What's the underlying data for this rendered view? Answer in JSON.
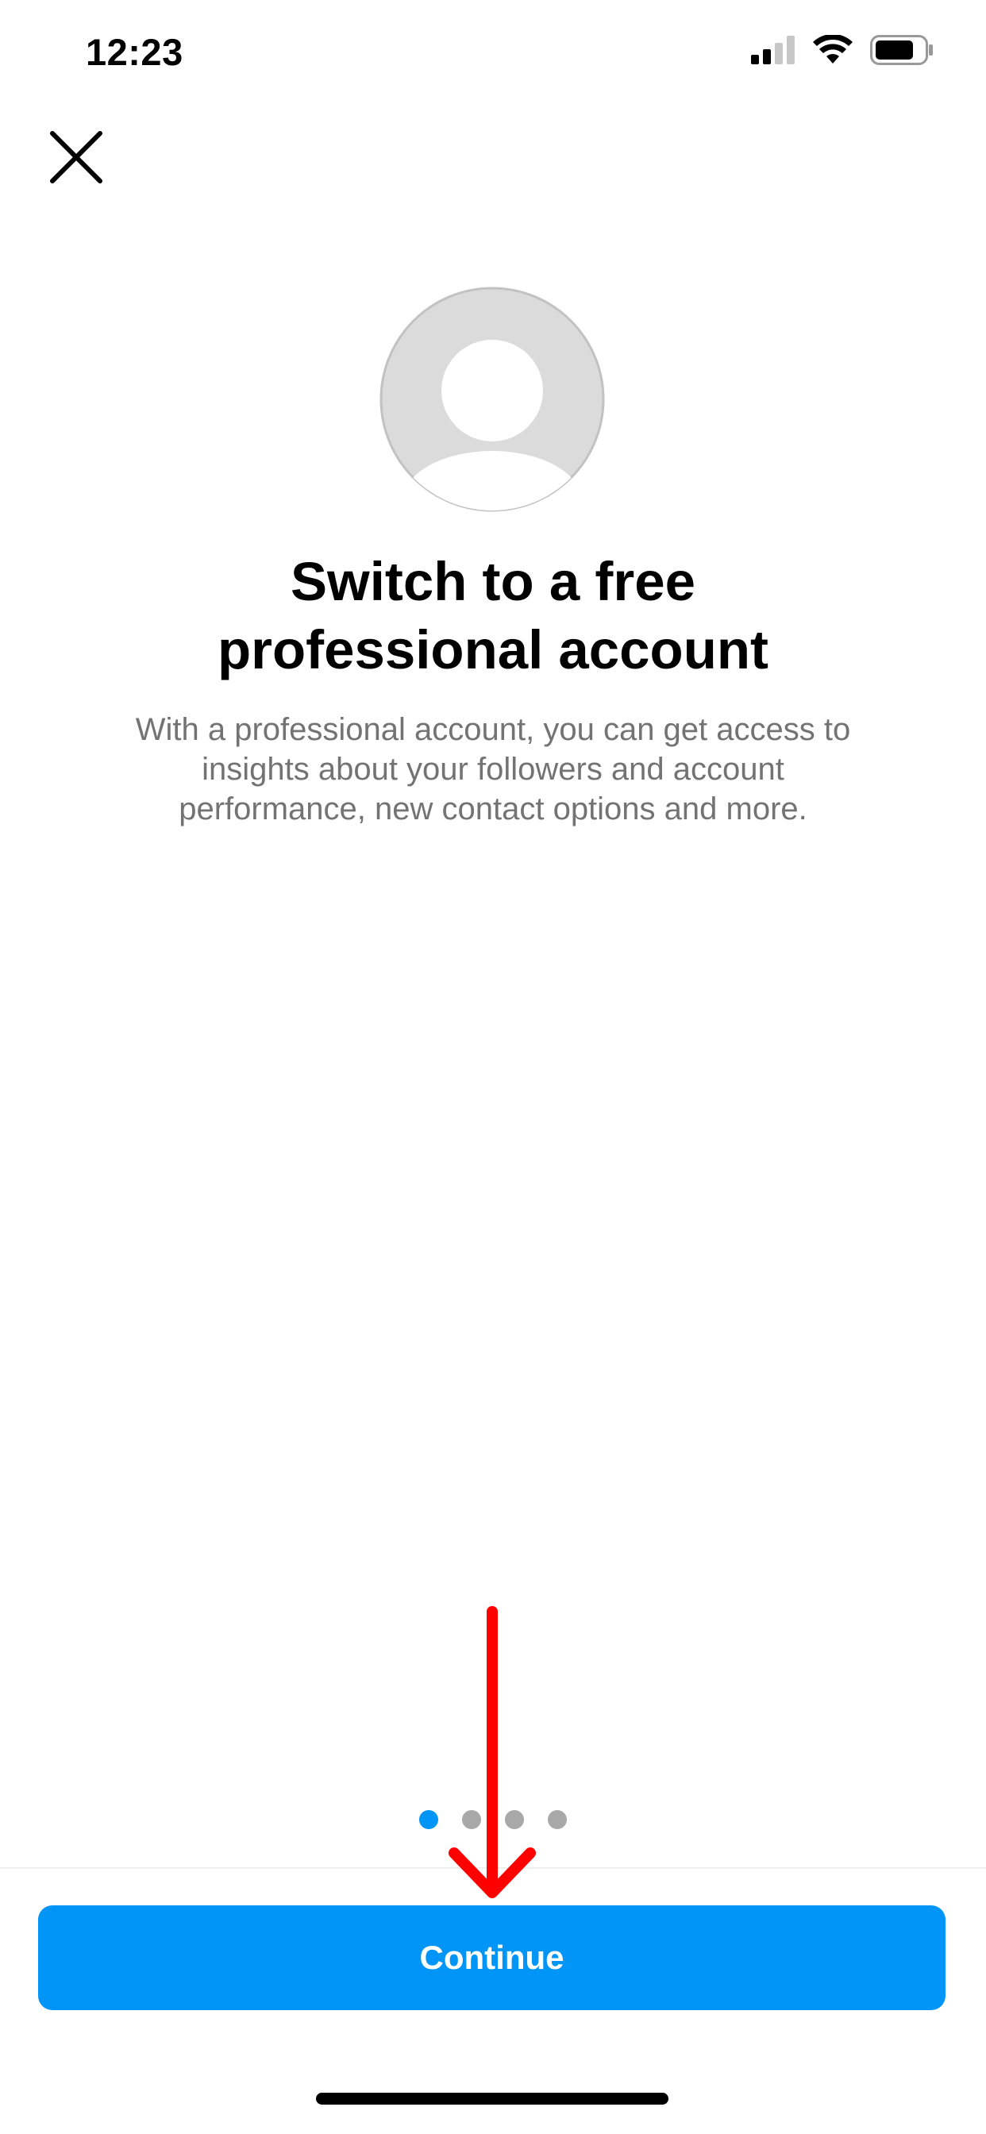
{
  "status_bar": {
    "time": "12:23",
    "signal_icon": "cellular-signal-icon",
    "wifi_icon": "wifi-icon",
    "battery_icon": "battery-icon"
  },
  "header": {
    "close_icon": "close-icon"
  },
  "avatar": {
    "icon": "default-profile-avatar-icon"
  },
  "content": {
    "title_lines": [
      "Switch to a free",
      "professional account"
    ],
    "description_lines": [
      "With a professional account, you can get access to",
      "insights about your followers and account",
      "performance, new contact options and more."
    ]
  },
  "pager": {
    "total": 4,
    "active_index": 0
  },
  "footer": {
    "continue_label": "Continue"
  },
  "colors": {
    "accent": "#0095f6",
    "secondary_text": "#737373",
    "inactive_dot": "#a8a8a8",
    "annotation_arrow": "#ff0000"
  },
  "annotation": {
    "icon": "red-down-arrow-icon"
  }
}
